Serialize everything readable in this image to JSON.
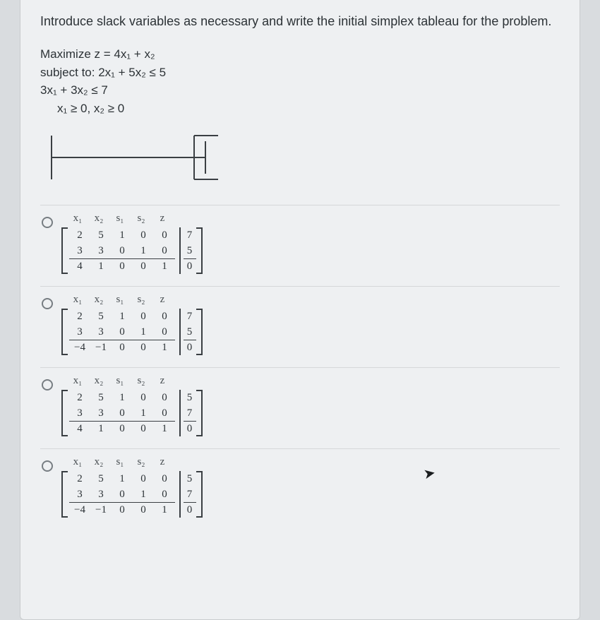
{
  "question": {
    "prompt": "Introduce slack variables as necessary and write the initial simplex tableau for the problem.",
    "maximize": "Maximize z = 4x₁ + x₂",
    "subject_to": "subject to: 2x₁ + 5x₂ ≤ 5",
    "constraint2": "3x₁ + 3x₂ ≤ 7",
    "nonneg": "x₁ ≥ 0, x₂ ≥ 0"
  },
  "headers": {
    "x1": "x₁",
    "x2": "x₂",
    "s1": "s₁",
    "s2": "s₂",
    "z": "z"
  },
  "options": [
    {
      "rows": [
        {
          "c": [
            "2",
            "5",
            "1",
            "0",
            "0"
          ],
          "r": "7"
        },
        {
          "c": [
            "3",
            "3",
            "0",
            "1",
            "0"
          ],
          "r": "5"
        },
        {
          "c": [
            "4",
            "1",
            "0",
            "0",
            "1"
          ],
          "r": "0",
          "obj": true
        }
      ]
    },
    {
      "rows": [
        {
          "c": [
            "2",
            "5",
            "1",
            "0",
            "0"
          ],
          "r": "7"
        },
        {
          "c": [
            "3",
            "3",
            "0",
            "1",
            "0"
          ],
          "r": "5"
        },
        {
          "c": [
            "−4",
            "−1",
            "0",
            "0",
            "1"
          ],
          "r": "0",
          "obj": true
        }
      ]
    },
    {
      "rows": [
        {
          "c": [
            "2",
            "5",
            "1",
            "0",
            "0"
          ],
          "r": "5"
        },
        {
          "c": [
            "3",
            "3",
            "0",
            "1",
            "0"
          ],
          "r": "7"
        },
        {
          "c": [
            "4",
            "1",
            "0",
            "0",
            "1"
          ],
          "r": "0",
          "obj": true
        }
      ]
    },
    {
      "rows": [
        {
          "c": [
            "2",
            "5",
            "1",
            "0",
            "0"
          ],
          "r": "5"
        },
        {
          "c": [
            "3",
            "3",
            "0",
            "1",
            "0"
          ],
          "r": "7"
        },
        {
          "c": [
            "−4",
            "−1",
            "0",
            "0",
            "1"
          ],
          "r": "0",
          "obj": true
        }
      ]
    }
  ]
}
